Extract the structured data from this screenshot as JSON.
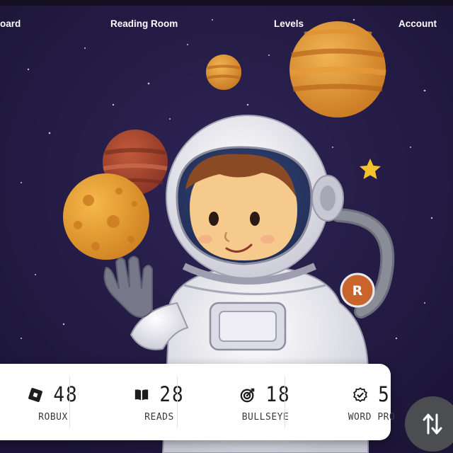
{
  "nav": {
    "items": [
      {
        "label": "oard"
      },
      {
        "label": "Reading Room"
      },
      {
        "label": "Levels"
      },
      {
        "label": "Account"
      }
    ]
  },
  "stats": [
    {
      "value": "48",
      "label": "ROBUX",
      "icon": "robux-icon"
    },
    {
      "value": "28",
      "label": "READS",
      "icon": "book-icon"
    },
    {
      "value": "18",
      "label": "BULLSEYE",
      "icon": "target-icon"
    },
    {
      "value": "5",
      "label": "WORD PRO",
      "icon": "badge-check-icon"
    }
  ],
  "colors": {
    "background": "#231a45",
    "card": "#ffffff",
    "fab": "#4b4d50",
    "badge": "#c9652c"
  },
  "fab": {
    "icon": "swap-vertical-icon"
  }
}
